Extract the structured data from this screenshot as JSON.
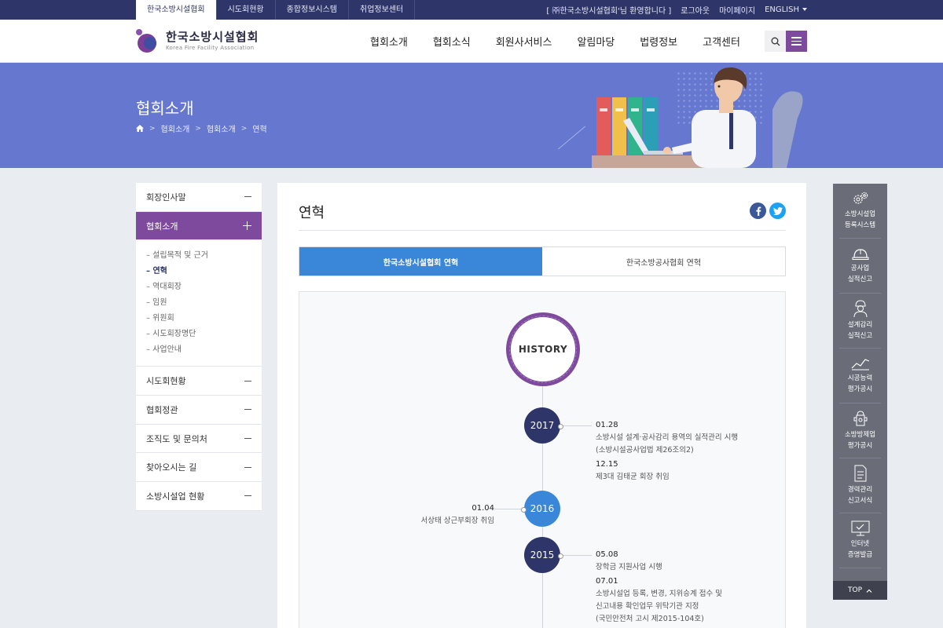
{
  "topbar": {
    "tabs": [
      "한국소방시설협회",
      "시도회현황",
      "종합정보시스템",
      "취업정보센터"
    ],
    "welcome": "[ ㈜한국소방시설협회'님 환영합니다 ]",
    "logout": "로그아웃",
    "mypage": "마이페이지",
    "lang": "ENGLISH"
  },
  "header": {
    "logo_ko": "한국소방시설협회",
    "logo_en": "Korea Fire Facility Association",
    "nav": [
      "협회소개",
      "협회소식",
      "회원사서비스",
      "알림마당",
      "법령정보",
      "고객센터"
    ]
  },
  "banner": {
    "title": "협회소개",
    "crumbs": [
      "협회소개",
      "협회소개",
      "연혁"
    ]
  },
  "lnb": {
    "items": [
      "회장인사말",
      "협회소개",
      "시도회현황",
      "협회정관",
      "조직도 및 문의처",
      "찾아오시는 길",
      "소방시설업 현황"
    ],
    "sub": [
      "– 설립목적 및 근거",
      "– 연혁",
      "– 역대회장",
      "– 임원",
      "– 위원회",
      "– 시도회장명단",
      "– 사업안내"
    ]
  },
  "content": {
    "heading": "연혁",
    "tabs": [
      "한국소방시설협회 연혁",
      "한국소방공사협회 연혁"
    ],
    "history_label": "HISTORY",
    "years": [
      {
        "year": "2017",
        "events": [
          {
            "date": "01.28",
            "lines": [
              "소방시설 설계·공사감리 용역의 실적관리 시행",
              "(소방시설공사업법 제26조의2)"
            ]
          },
          {
            "date": "12.15",
            "lines": [
              "제3대 김태균 회장 취임"
            ]
          }
        ]
      },
      {
        "year": "2016",
        "events": [
          {
            "date": "01.04",
            "lines": [
              "서상태 상근부회장 취임"
            ]
          }
        ]
      },
      {
        "year": "2015",
        "events": [
          {
            "date": "05.08",
            "lines": [
              "장학금 지원사업 시행"
            ]
          },
          {
            "date": "07.01",
            "lines": [
              "소방시설업 등록, 변경, 지위승계 접수 및",
              "신고내용 확인업무 위탁기관 지정",
              "(국민안전처 고시 제2015-104호)"
            ]
          }
        ]
      }
    ]
  },
  "quick": {
    "items": [
      {
        "l1": "소방시설업",
        "l2": "등록시스템",
        "icon": "gears-icon"
      },
      {
        "l1": "공사업",
        "l2": "실적신고",
        "icon": "helmet-icon"
      },
      {
        "l1": "설계감리",
        "l2": "실적신고",
        "icon": "worker-icon"
      },
      {
        "l1": "시공능력",
        "l2": "평가공시",
        "icon": "chart-icon"
      },
      {
        "l1": "소방방제업",
        "l2": "평가공시",
        "icon": "hydrant-icon"
      },
      {
        "l1": "경력관리",
        "l2": "신고서식",
        "icon": "document-icon"
      },
      {
        "l1": "인터넷",
        "l2": "증명발급",
        "icon": "monitor-icon"
      }
    ],
    "top": "TOP"
  },
  "colors": {
    "navy": "#2e3568",
    "purple": "#7d4a9e",
    "blue": "#3a86d8",
    "banner": "#6677cf"
  }
}
